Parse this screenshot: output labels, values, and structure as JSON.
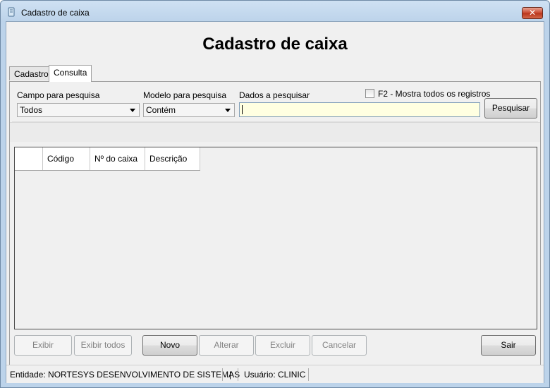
{
  "window": {
    "title": "Cadastro de caixa",
    "close_label": "✕"
  },
  "header": {
    "title": "Cadastro de caixa"
  },
  "tabs": [
    {
      "label": "Cadastro",
      "active": false
    },
    {
      "label": "Consulta",
      "active": true
    }
  ],
  "search": {
    "field_label": "Campo para pesquisa",
    "field_value": "Todos",
    "model_label": "Modelo para pesquisa",
    "model_value": "Contém",
    "data_label": "Dados a pesquisar",
    "data_value": "",
    "show_all_label": "F2 - Mostra todos os registros",
    "show_all_checked": false,
    "search_button": "Pesquisar"
  },
  "grid": {
    "columns": [
      "",
      "Código",
      "Nº do caixa",
      "Descrição"
    ]
  },
  "buttons": {
    "exibir": "Exibir",
    "exibir_todos": "Exibir todos",
    "novo": "Novo",
    "alterar": "Alterar",
    "excluir": "Excluir",
    "cancelar": "Cancelar",
    "sair": "Sair"
  },
  "status": {
    "entity": "Entidade: NORTESYS DESENVOLVIMENTO DE SISTEMAS",
    "separator": "|",
    "user": "Usuário: CLINIC"
  },
  "colors": {
    "input_background": "#ffffe1",
    "title_bar": "#bcd3ea",
    "close_button": "#c9462c"
  }
}
